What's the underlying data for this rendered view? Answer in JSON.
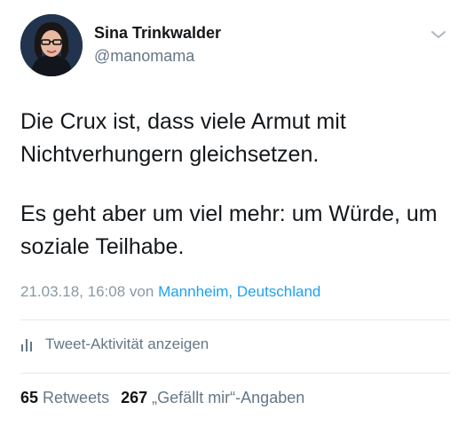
{
  "user": {
    "name": "Sina Trinkwalder",
    "handle": "@manomama"
  },
  "tweet": {
    "paragraphs": [
      "Die Crux ist, dass viele Armut mit Nichtverhungern gleichsetzen.",
      "Es geht aber um viel mehr: um Würde, um soziale Teilhabe."
    ],
    "timestamp": "21.03.18, 16:08",
    "from_label": "von",
    "location": "Mannheim, Deutschland"
  },
  "activity": {
    "label": "Tweet-Aktivität anzeigen",
    "icon": "bar-chart-icon"
  },
  "stats": {
    "retweets_count": "65",
    "retweets_label": "Retweets",
    "likes_count": "267",
    "likes_label": "„Gefällt mir“-Angaben"
  },
  "colors": {
    "text": "#14171a",
    "secondary": "#657786",
    "link": "#1da1f2",
    "divider": "#e1e8ed"
  }
}
